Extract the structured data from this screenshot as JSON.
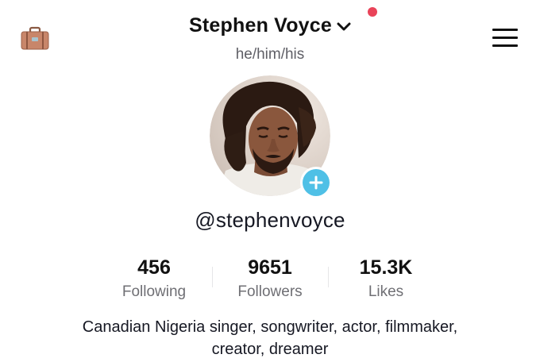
{
  "header": {
    "display_name": "Stephen Voyce",
    "pronouns": "he/him/his"
  },
  "icons": {
    "left": "briefcase-icon",
    "name_dropdown": "chevron-down-icon",
    "right": "hamburger-menu-icon",
    "add": "plus-icon"
  },
  "profile": {
    "username": "@stephenvoyce",
    "bio_line1": "Canadian Nigeria singer, songwriter, actor, filmmaker,",
    "bio_line2": "creator, dreamer"
  },
  "stats": [
    {
      "value": "456",
      "label": "Following"
    },
    {
      "value": "9651",
      "label": "Followers"
    },
    {
      "value": "15.3K",
      "label": "Likes"
    }
  ],
  "colors": {
    "notification_dot": "#e94359",
    "add_button": "#4fc0e6",
    "secondary_text": "#6f6f74"
  }
}
